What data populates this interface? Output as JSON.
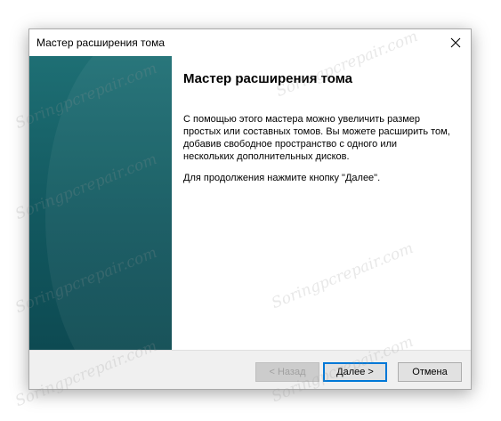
{
  "window": {
    "title": "Мастер расширения тома"
  },
  "title_bar": {
    "close_icon": "close-icon"
  },
  "content": {
    "heading": "Мастер расширения тома",
    "description": "С помощью этого мастера можно увеличить размер простых или составных томов. Вы можете расширить том, добавив свободное пространство с одного или нескольких дополнительных дисков.",
    "continue_text": "Для продолжения нажмите кнопку \"Далее\"."
  },
  "buttons": {
    "back": "< Назад",
    "next": "Далее >",
    "cancel": "Отмена"
  },
  "colors": {
    "sidebar": "#14606a",
    "accent_focus": "#0078d7",
    "footer": "#f0f0f0"
  },
  "watermark": "Soringpcrepair.com"
}
